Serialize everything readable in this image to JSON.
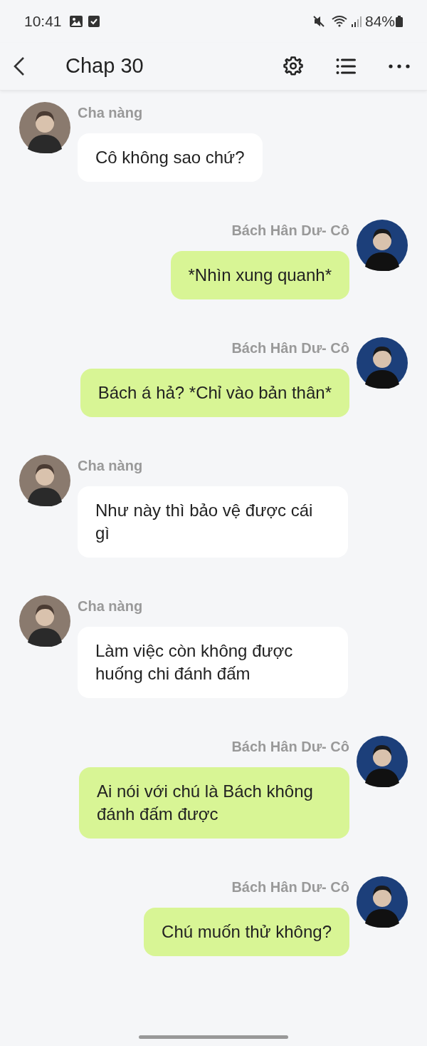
{
  "status_bar": {
    "time": "10:41",
    "battery": "84%"
  },
  "header": {
    "title": "Chap 30"
  },
  "messages": [
    {
      "kind": "left",
      "sender": "Cha nàng",
      "text": "Cô không sao chứ?"
    },
    {
      "kind": "right",
      "sender": "Bách Hân Dư- Cô",
      "text": "*Nhìn xung quanh*"
    },
    {
      "kind": "right",
      "sender": "Bách Hân Dư- Cô",
      "text": "Bách á hả? *Chỉ vào bản thân*"
    },
    {
      "kind": "left",
      "sender": "Cha nàng",
      "text": "Như này thì bảo vệ được cái gì"
    },
    {
      "kind": "left",
      "sender": "Cha nàng",
      "text": "Làm việc còn không được huống chi đánh đấm"
    },
    {
      "kind": "right",
      "sender": "Bách Hân Dư- Cô",
      "text": "Ai nói với chú là Bách không đánh đấm được"
    },
    {
      "kind": "right",
      "sender": "Bách Hân Dư- Cô",
      "text": "Chú muốn thử không?"
    }
  ]
}
